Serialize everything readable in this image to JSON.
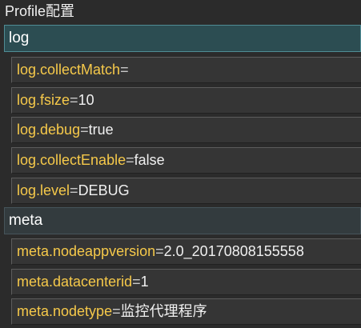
{
  "panel": {
    "title": "Profile配置"
  },
  "groups": [
    {
      "name": "log",
      "properties": [
        {
          "key": "log.collectMatch",
          "sep": "=",
          "value": ""
        },
        {
          "key": "log.fsize",
          "sep": "=",
          "value": "10"
        },
        {
          "key": "log.debug",
          "sep": "=",
          "value": "true"
        },
        {
          "key": "log.collectEnable",
          "sep": "=",
          "value": "false"
        },
        {
          "key": "log.level",
          "sep": "=",
          "value": "DEBUG"
        }
      ]
    },
    {
      "name": "meta",
      "properties": [
        {
          "key": "meta.nodeappversion",
          "sep": "=",
          "value": "2.0_20170808155558"
        },
        {
          "key": "meta.datacenterid",
          "sep": "=",
          "value": "1"
        },
        {
          "key": "meta.nodetype",
          "sep": "=",
          "value": "监控代理程序"
        }
      ]
    }
  ],
  "colors": {
    "background": "#2b2b2b",
    "key_text": "#f6c94a",
    "value_text": "#f0f0f0",
    "selected_group": "#2c4d52"
  }
}
